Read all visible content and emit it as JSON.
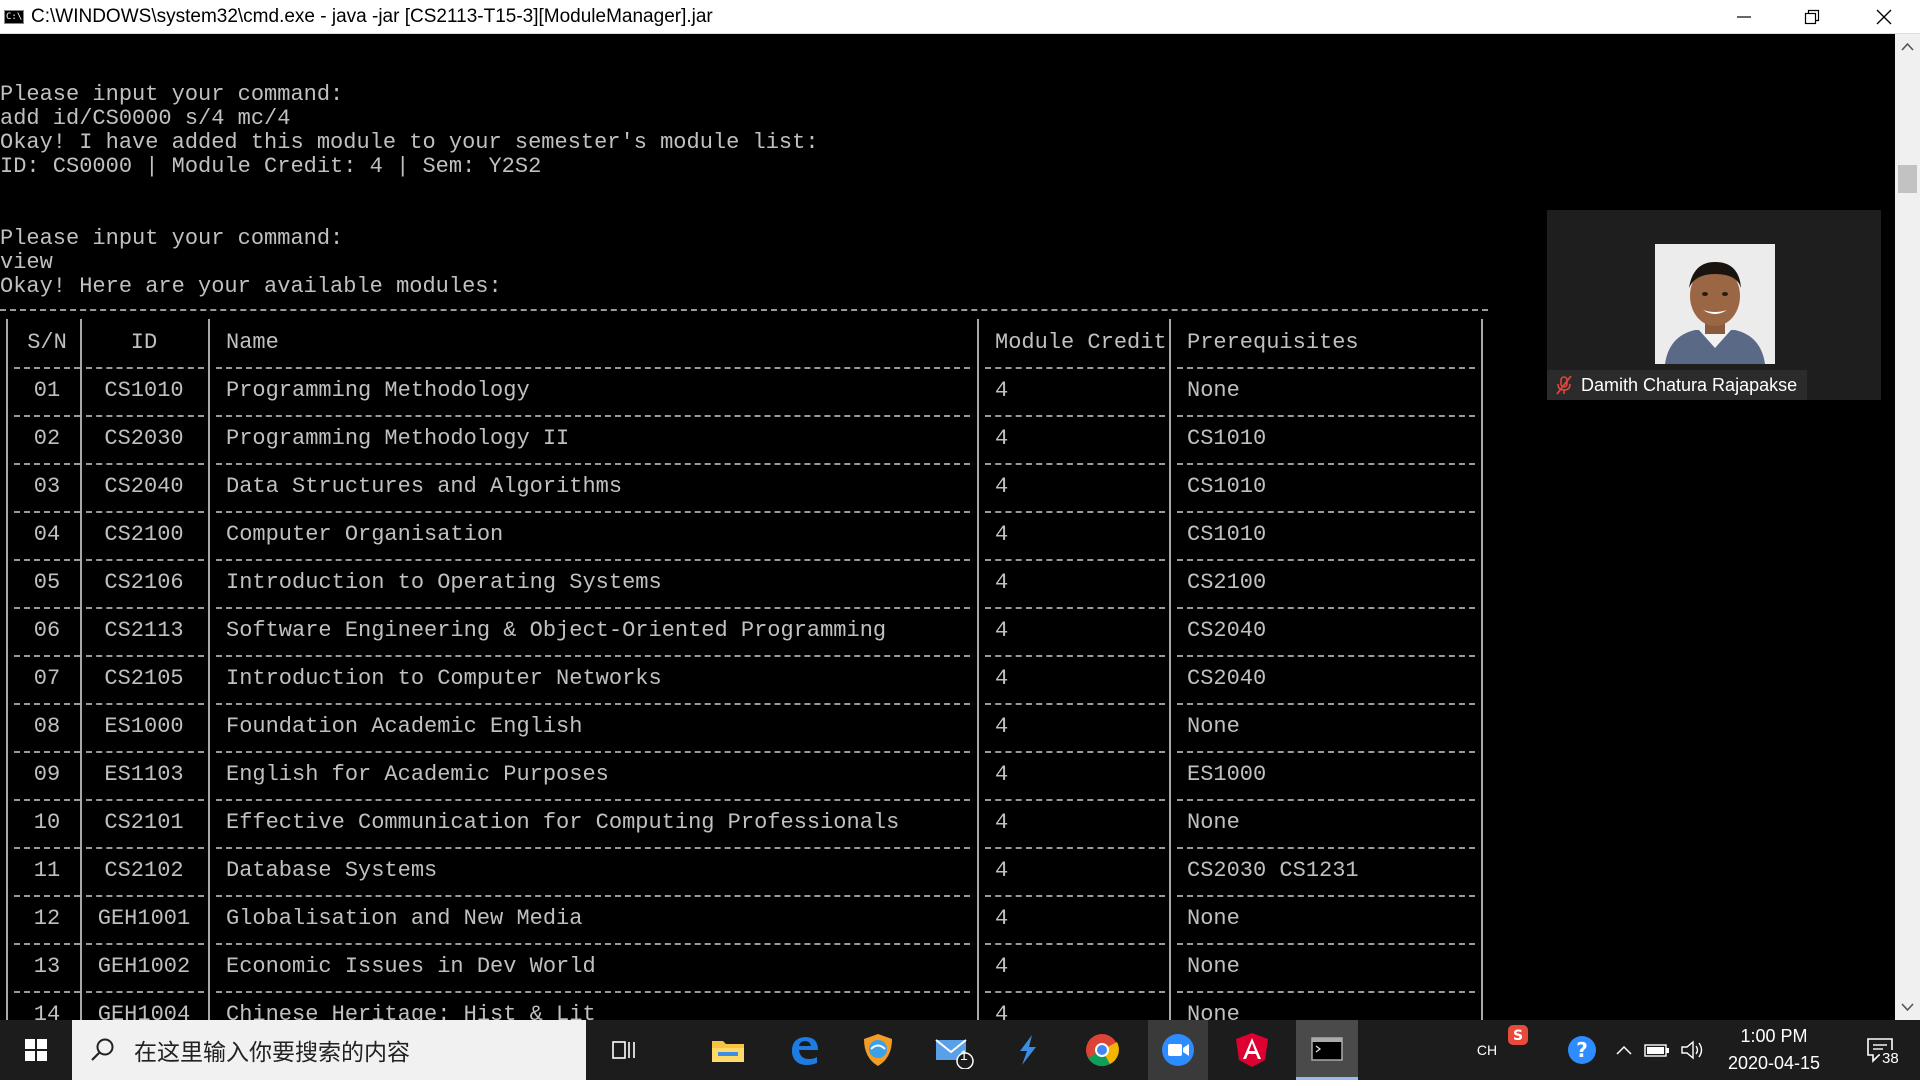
{
  "window": {
    "title": "C:\\WINDOWS\\system32\\cmd.exe - java  -jar [CS2113-T15-3][ModuleManager].jar",
    "icon_label": "C:\\"
  },
  "console": {
    "lines": [
      "Please input your command:",
      "add id/CS0000 s/4 mc/4",
      "Okay! I have added this module to your semester's module list:",
      "ID: CS0000 | Module Credit: 4 | Sem: Y2S2",
      "Please input your command:",
      "view",
      "Okay! Here are your available modules:"
    ]
  },
  "table": {
    "headers": [
      "S/N",
      "ID",
      "Name",
      "Module Credit",
      "Prerequisites"
    ],
    "rows": [
      [
        "01",
        "CS1010",
        "Programming Methodology",
        "4",
        "None"
      ],
      [
        "02",
        "CS2030",
        "Programming Methodology II",
        "4",
        "CS1010"
      ],
      [
        "03",
        "CS2040",
        "Data Structures and Algorithms",
        "4",
        "CS1010"
      ],
      [
        "04",
        "CS2100",
        "Computer Organisation",
        "4",
        "CS1010"
      ],
      [
        "05",
        "CS2106",
        "Introduction to Operating Systems",
        "4",
        "CS2100"
      ],
      [
        "06",
        "CS2113",
        "Software Engineering & Object-Oriented Programming",
        "4",
        "CS2040"
      ],
      [
        "07",
        "CS2105",
        "Introduction to Computer Networks",
        "4",
        "CS2040"
      ],
      [
        "08",
        "ES1000",
        "Foundation Academic English",
        "4",
        "None"
      ],
      [
        "09",
        "ES1103",
        "English for Academic Purposes",
        "4",
        "ES1000"
      ],
      [
        "10",
        "CS2101",
        "Effective Communication for Computing Professionals",
        "4",
        "None"
      ],
      [
        "11",
        "CS2102",
        "Database Systems",
        "4",
        "CS2030 CS1231"
      ],
      [
        "12",
        "GEH1001",
        "Globalisation and New Media",
        "4",
        "None"
      ],
      [
        "13",
        "GEH1002",
        "Economic Issues in Dev World",
        "4",
        "None"
      ],
      [
        "14",
        "GEH1004",
        "Chinese Heritage: Hist & Lit",
        "4",
        "None"
      ]
    ]
  },
  "video": {
    "participant_name": "Damith Chatura Rajapakse"
  },
  "taskbar": {
    "search_placeholder": "在这里输入你要搜索的内容",
    "mail_badge": "1",
    "ime_label": "CH",
    "time": "1:00 PM",
    "date": "2020-04-15",
    "notification_count": "38"
  },
  "colors": {
    "console_bg": "#000000",
    "console_text": "#c0c0c0",
    "taskbar_bg": "#1c1c1c",
    "active_app_highlight": "#4a4a4a"
  }
}
